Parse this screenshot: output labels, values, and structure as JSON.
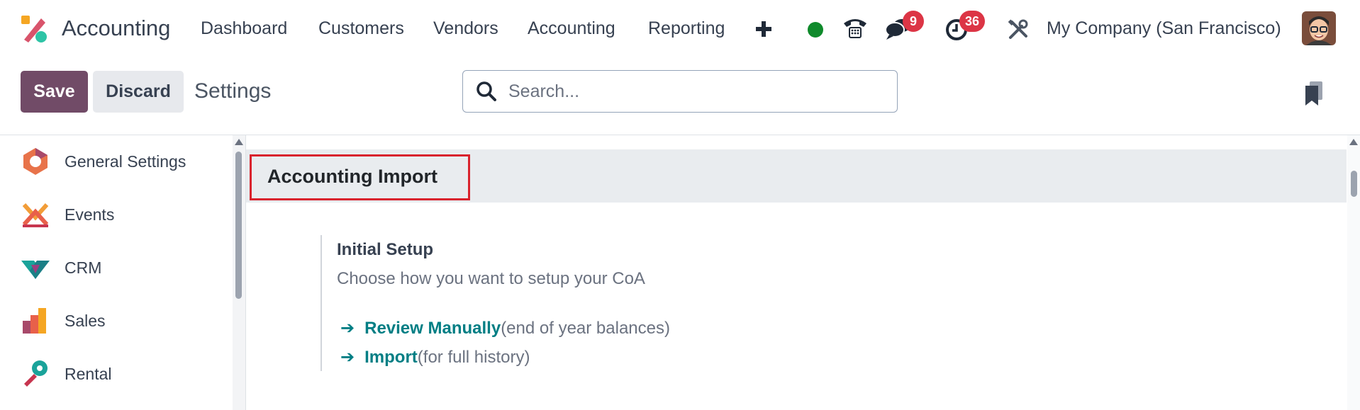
{
  "topnav": {
    "app_name": "Accounting",
    "menu_items": [
      {
        "label": "Dashboard"
      },
      {
        "label": "Customers"
      },
      {
        "label": "Vendors"
      },
      {
        "label": "Accounting"
      },
      {
        "label": "Reporting"
      }
    ],
    "messages_count": "9",
    "activities_count": "36",
    "company": "My Company (San Francisco)",
    "status_color": "#0f8a2b"
  },
  "control_panel": {
    "save_label": "Save",
    "discard_label": "Discard",
    "title": "Settings",
    "search_placeholder": "Search..."
  },
  "sidebar": {
    "items": [
      {
        "label": "General Settings",
        "icon": "general-settings-icon"
      },
      {
        "label": "Events",
        "icon": "events-icon"
      },
      {
        "label": "CRM",
        "icon": "crm-icon"
      },
      {
        "label": "Sales",
        "icon": "sales-icon"
      },
      {
        "label": "Rental",
        "icon": "rental-icon"
      }
    ]
  },
  "main": {
    "section_title": "Accounting Import",
    "setting": {
      "title": "Initial Setup",
      "description": "Choose how you want to setup your CoA",
      "links": [
        {
          "arrow": "➔",
          "label": "Review Manually",
          "note": "(end of year balances)"
        },
        {
          "arrow": "➔",
          "label": "Import",
          "note": "(for full history)"
        }
      ]
    }
  },
  "colors": {
    "brand": "#714b67",
    "link": "#017e84",
    "badge": "#dc3545",
    "highlight": "#d9232d"
  }
}
